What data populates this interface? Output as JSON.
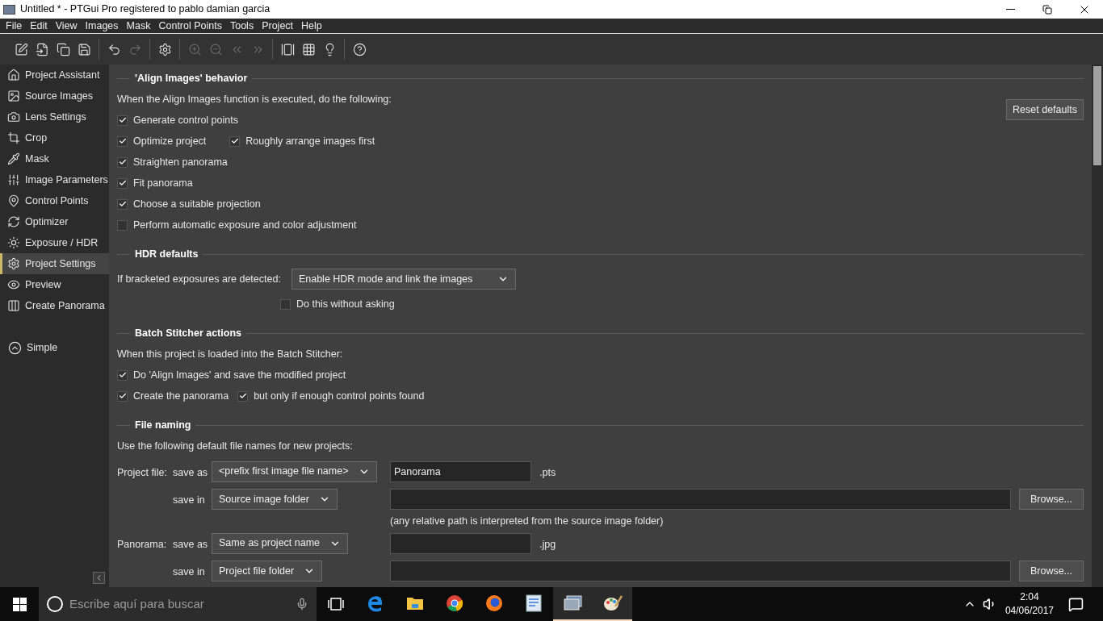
{
  "window": {
    "title": "Untitled * - PTGui Pro registered to pablo damian garcia"
  },
  "menu": [
    "File",
    "Edit",
    "View",
    "Images",
    "Mask",
    "Control Points",
    "Tools",
    "Project",
    "Help"
  ],
  "toolbar": [
    [
      {
        "kind": "new",
        "disabled": false
      },
      {
        "kind": "open",
        "disabled": false
      },
      {
        "kind": "duplicate",
        "disabled": false
      },
      {
        "kind": "save",
        "disabled": false
      }
    ],
    [
      {
        "kind": "undo",
        "disabled": false
      },
      {
        "kind": "redo",
        "disabled": true
      }
    ],
    [
      {
        "kind": "settings",
        "disabled": false
      }
    ],
    [
      {
        "kind": "zoom-in",
        "disabled": true
      },
      {
        "kind": "zoom-out",
        "disabled": true
      },
      {
        "kind": "previous",
        "disabled": true
      },
      {
        "kind": "next",
        "disabled": true
      }
    ],
    [
      {
        "kind": "panorama-editor",
        "disabled": false
      },
      {
        "kind": "table",
        "disabled": false
      },
      {
        "kind": "tip",
        "disabled": false
      }
    ],
    [
      {
        "kind": "help",
        "disabled": false
      }
    ]
  ],
  "sidebar": {
    "items": [
      {
        "kind": "assistant",
        "label": "Project Assistant",
        "selected": false
      },
      {
        "kind": "source",
        "label": "Source Images",
        "selected": false
      },
      {
        "kind": "lens",
        "label": "Lens Settings",
        "selected": false
      },
      {
        "kind": "crop",
        "label": "Crop",
        "selected": false
      },
      {
        "kind": "mask",
        "label": "Mask",
        "selected": false
      },
      {
        "kind": "parameters",
        "label": "Image Parameters",
        "selected": false
      },
      {
        "kind": "points",
        "label": "Control Points",
        "selected": false
      },
      {
        "kind": "optimizer",
        "label": "Optimizer",
        "selected": false
      },
      {
        "kind": "exposure",
        "label": "Exposure / HDR",
        "selected": false
      },
      {
        "kind": "settings",
        "label": "Project Settings",
        "selected": true
      },
      {
        "kind": "preview",
        "label": "Preview",
        "selected": false
      },
      {
        "kind": "create",
        "label": "Create Panorama",
        "selected": false
      }
    ],
    "mode_button": "Simple"
  },
  "align": {
    "title": "'Align Images' behavior",
    "intro": "When the Align Images function is executed, do the following:",
    "reset_button": "Reset defaults",
    "rows": [
      [
        {
          "label": "Generate control points",
          "checked": true
        }
      ],
      [
        {
          "label": "Optimize project",
          "checked": true
        },
        {
          "label": "Roughly arrange images first",
          "checked": true
        }
      ],
      [
        {
          "label": "Straighten panorama",
          "checked": true
        }
      ],
      [
        {
          "label": "Fit panorama",
          "checked": true
        }
      ],
      [
        {
          "label": "Choose a suitable projection",
          "checked": true
        }
      ],
      [
        {
          "label": "Perform automatic exposure and color adjustment",
          "checked": false
        }
      ]
    ]
  },
  "hdr": {
    "title": "HDR defaults",
    "label": "If bracketed exposures are detected:",
    "dropdown": "Enable HDR mode and link the images",
    "checkbox": {
      "label": "Do this without asking",
      "checked": false
    }
  },
  "batch": {
    "title": "Batch Stitcher actions",
    "intro": "When this project is loaded into the Batch Stitcher:",
    "rows": [
      [
        {
          "label": "Do 'Align Images' and save the modified project",
          "checked": true
        }
      ],
      [
        {
          "label": "Create the panorama",
          "checked": true
        },
        {
          "label": "but only if enough control points found",
          "checked": true
        }
      ]
    ]
  },
  "file_naming": {
    "title": "File naming",
    "intro": "Use the following default file names for new projects:",
    "rows": [
      {
        "kind": "name",
        "label": "Project file:",
        "sub": "save as",
        "dropdown": "<prefix first image file name>",
        "value": "Panorama",
        "suffix": ".pts"
      },
      {
        "kind": "folder",
        "sub": "save in",
        "dropdown": "Source image folder",
        "button": "Browse...",
        "hint": "(any relative path is interpreted from the source image folder)"
      },
      {
        "kind": "name",
        "label": "Panorama:",
        "sub": "save as",
        "dropdown": "Same as project name",
        "suffix": ".jpg"
      },
      {
        "kind": "folder",
        "sub": "save in",
        "dropdown": "Project file folder",
        "button": "Browse..."
      }
    ]
  },
  "taskbar": {
    "search_placeholder": "Escribe aquí para buscar",
    "apps": [
      {
        "kind": "edge",
        "running": false
      },
      {
        "kind": "explorer",
        "running": false
      },
      {
        "kind": "chrome",
        "running": false
      },
      {
        "kind": "firefox",
        "running": false
      },
      {
        "kind": "document",
        "running": false
      },
      {
        "kind": "ptgui",
        "running": true
      },
      {
        "kind": "paint",
        "running": true
      }
    ],
    "time": "2:04",
    "date": "04/06/2017"
  }
}
